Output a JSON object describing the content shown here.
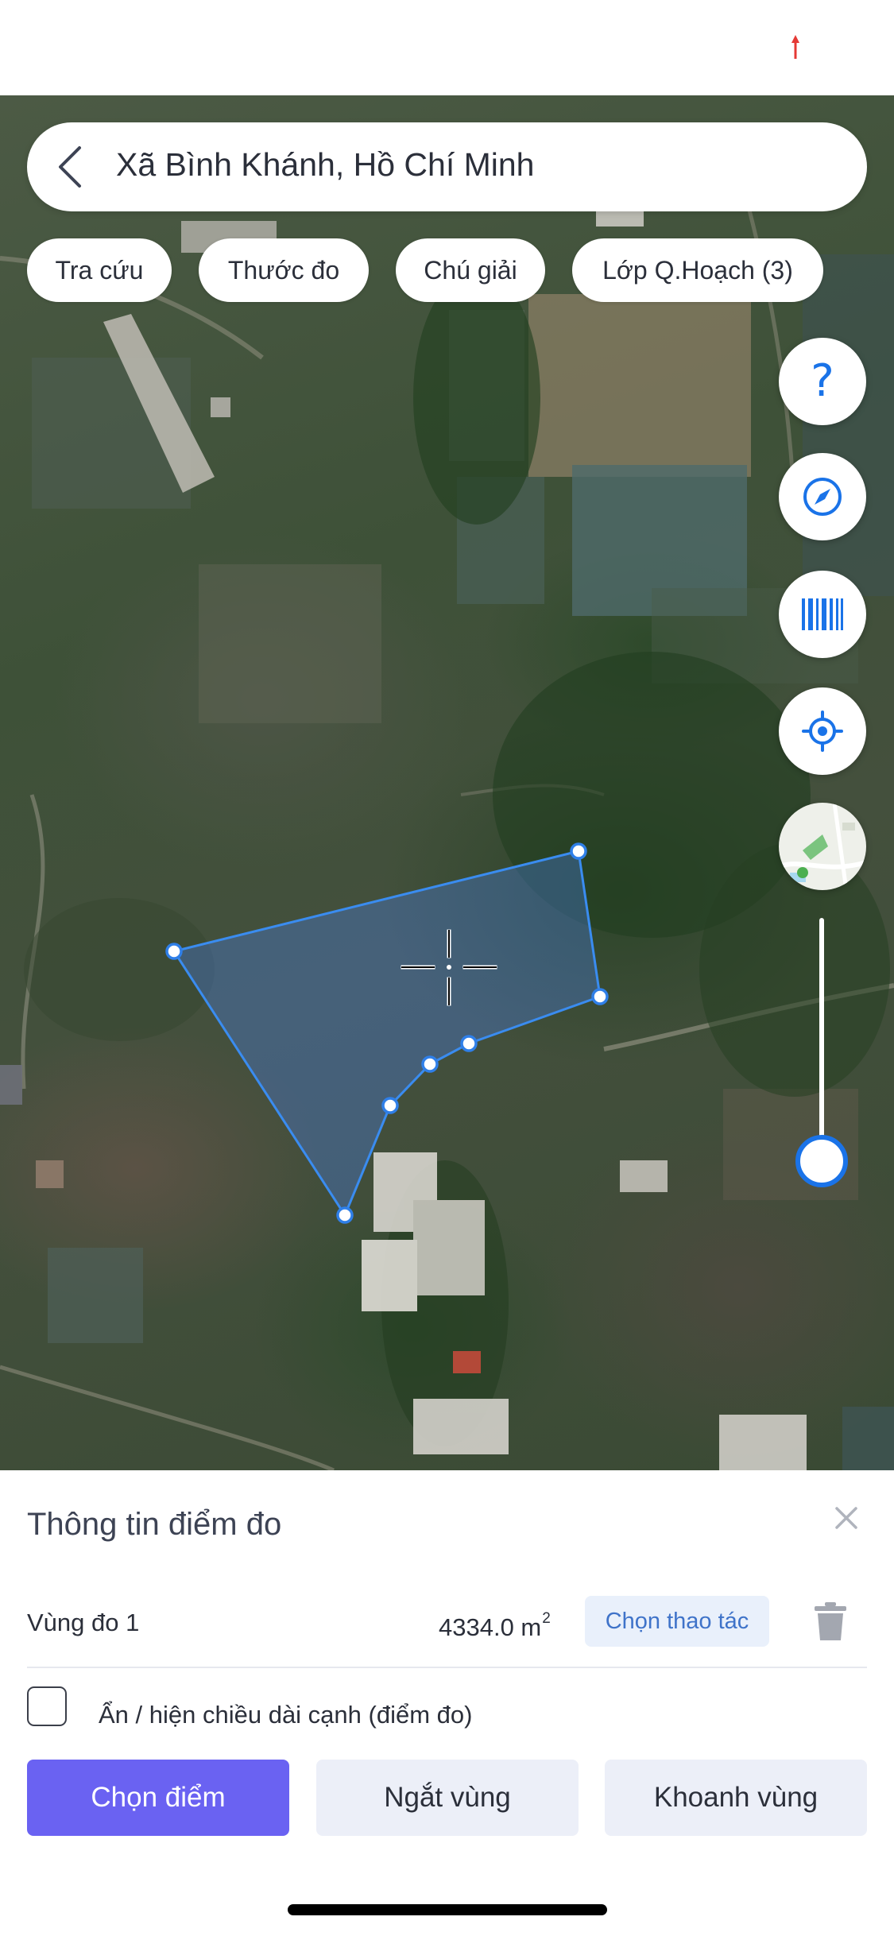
{
  "search": {
    "location": "Xã Bình Khánh, Hồ Chí Minh",
    "back_icon": "chevron-left-icon"
  },
  "chips": [
    "Tra cứu",
    "Thước đo",
    "Chú giải",
    "Lớp Q.Hoạch (3)"
  ],
  "map_controls": {
    "help_label": "?",
    "icons": [
      "help-icon",
      "compass-icon",
      "barcode-icon",
      "locate-icon",
      "minimap-icon"
    ],
    "zoom_slider_level": 0.88
  },
  "panel": {
    "title": "Thông tin điểm đo",
    "zone_name": "Vùng đo 1",
    "area_value": "4334.0 m",
    "area_unit_sup": "2",
    "action_label": "Chọn thao tác",
    "toggle_label": "Ẩn / hiện chiều dài cạnh (điểm đo)",
    "toggle_checked": false
  },
  "buttons": {
    "select_point": "Chọn điểm",
    "break_zone": "Ngắt vùng",
    "enclose_zone": "Khoanh vùng"
  },
  "colors": {
    "accent": "#1a73e8",
    "primary_button": "#6a62f2",
    "action_chip_bg": "#e9f0fb",
    "action_chip_text": "#3f73c9",
    "polygon_stroke": "#3a8cf0",
    "status_arrow": "#e53935"
  }
}
